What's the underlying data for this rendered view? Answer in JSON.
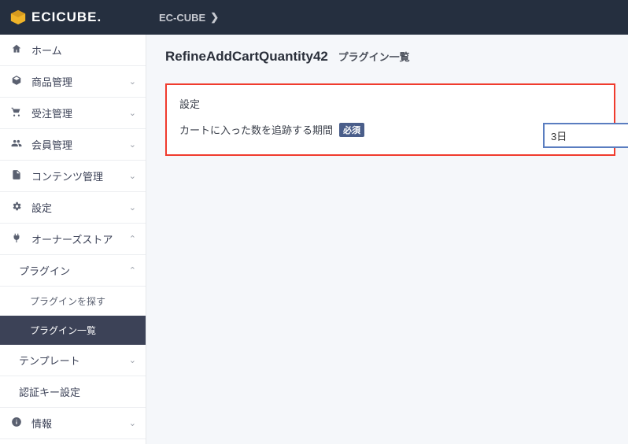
{
  "brand": {
    "logo_text": "ECICUBE.",
    "crumb": "EC-CUBE"
  },
  "sidebar": {
    "items": [
      {
        "label": "ホーム",
        "icon": "home",
        "expandable": false
      },
      {
        "label": "商品管理",
        "icon": "cube",
        "expandable": true,
        "expanded": false
      },
      {
        "label": "受注管理",
        "icon": "cart",
        "expandable": true,
        "expanded": false
      },
      {
        "label": "会員管理",
        "icon": "users",
        "expandable": true,
        "expanded": false
      },
      {
        "label": "コンテンツ管理",
        "icon": "file",
        "expandable": true,
        "expanded": false
      },
      {
        "label": "設定",
        "icon": "gear",
        "expandable": true,
        "expanded": false
      },
      {
        "label": "オーナーズストア",
        "icon": "plug",
        "expandable": true,
        "expanded": true,
        "subs": [
          {
            "label": "プラグイン",
            "expandable": true,
            "expanded": true,
            "subs": [
              {
                "label": "プラグインを探す",
                "active": false
              },
              {
                "label": "プラグイン一覧",
                "active": true
              }
            ]
          },
          {
            "label": "テンプレート",
            "expandable": true,
            "expanded": false
          },
          {
            "label": "認証キー設定",
            "expandable": false
          }
        ]
      },
      {
        "label": "情報",
        "icon": "info",
        "expandable": true,
        "expanded": false
      }
    ]
  },
  "page": {
    "title_main": "RefineAddCartQuantity42",
    "title_sub": "プラグイン一覧"
  },
  "settings_panel": {
    "heading": "設定",
    "field_label": "カートに入った数を追跡する期間",
    "required_badge": "必須",
    "select_value": "3日"
  }
}
